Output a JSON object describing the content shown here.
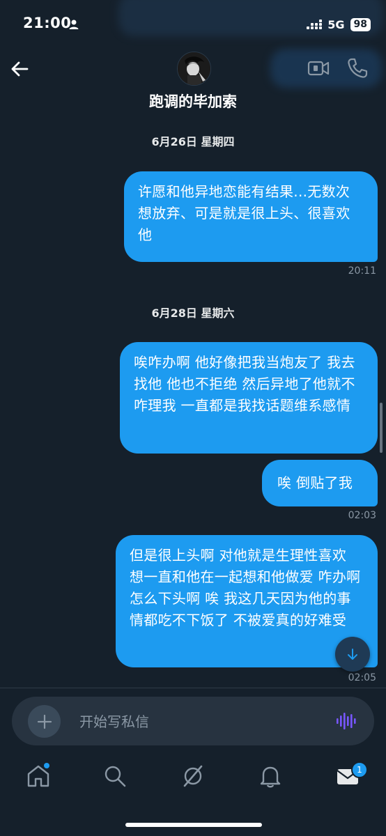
{
  "status_bar": {
    "time": "21:00",
    "network": "5G",
    "battery": "98"
  },
  "header": {
    "contact_name": "跑调的毕加索",
    "back_icon": "arrow-left-icon",
    "video_icon": "video-camera-icon",
    "call_icon": "phone-icon"
  },
  "conversation": {
    "date_1": "6月26日 星期四",
    "message_1": "许愿和他异地恋能有结果...无数次想放弃、可是就是很上头、很喜欢他",
    "time_1": "20:11",
    "date_2": "6月28日 星期六",
    "message_2": "唉咋办啊 他好像把我当炮友了 我去找他 他也不拒绝 然后异地了他就不咋理我 一直都是我找话题维系感情",
    "message_3": "唉 倒贴了我",
    "time_2": "02:03",
    "message_4": "但是很上头啊 对他就是生理性喜欢 想一直和他在一起想和他做爱 咋办啊 怎么下头啊 唉 我这几天因为他的事情都吃不下饭了 不被爱真的好难受",
    "time_3": "02:05"
  },
  "composer": {
    "placeholder": "开始写私信"
  },
  "nav": {
    "items": [
      "home-icon",
      "search-icon",
      "communities-icon",
      "notifications-icon",
      "messages-icon"
    ],
    "messages_badge": "1"
  },
  "colors": {
    "background": "#15202b",
    "accent": "#1d9bf0",
    "muted_text": "#8b98a5"
  }
}
